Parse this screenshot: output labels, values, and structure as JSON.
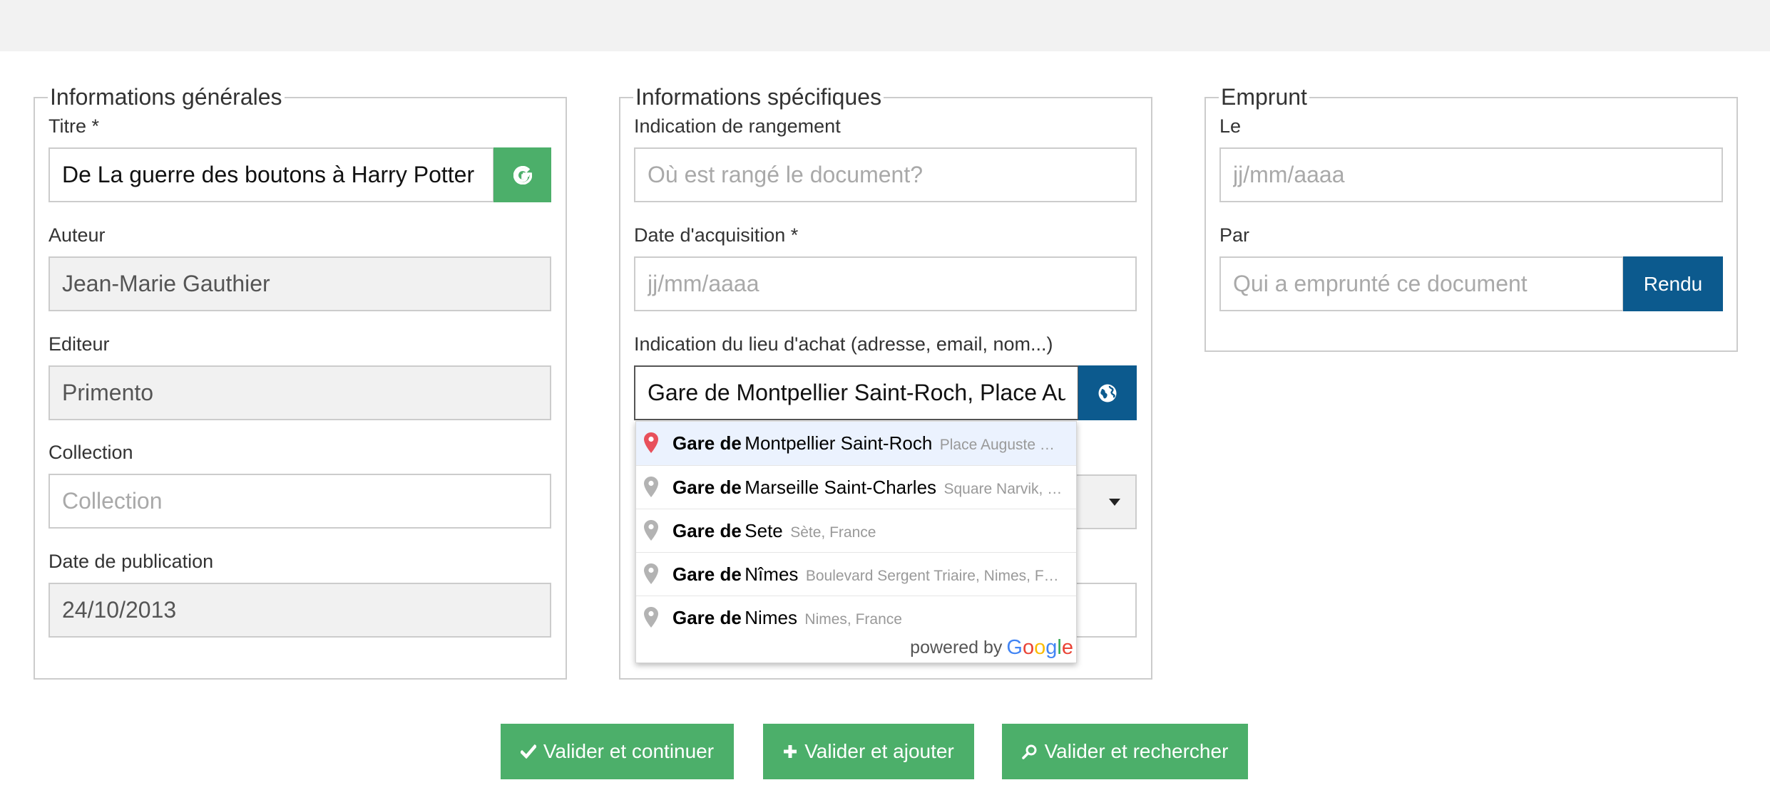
{
  "colors": {
    "green": "#4caf6a",
    "blue": "#0c5a8e",
    "border": "#cccccc",
    "readonly_bg": "#f1f1f1",
    "placeholder": "#a9a9a9"
  },
  "general": {
    "legend": "Informations générales",
    "titre_label": "Titre *",
    "titre_value": "De La guerre des boutons à Harry Potter",
    "google_button_icon": "google-g-icon",
    "auteur_label": "Auteur",
    "auteur_value": "Jean-Marie Gauthier",
    "editeur_label": "Editeur",
    "editeur_value": "Primento",
    "collection_label": "Collection",
    "collection_placeholder": "Collection",
    "date_label": "Date de publication",
    "date_value": "24/10/2013"
  },
  "specific": {
    "legend": "Informations spécifiques",
    "rangement_label": "Indication de rangement",
    "rangement_placeholder": "Où est rangé le document?",
    "acquisition_label": "Date d'acquisition *",
    "acquisition_placeholder": "jj/mm/aaaa",
    "lieu_label": "Indication du lieu d'achat (adresse, email, nom...)",
    "lieu_value": "Gare de Montpellier Saint-Roch, Place Auguste Gibert, Montpellier, France",
    "globe_button_icon": "globe-icon"
  },
  "autocomplete": {
    "items": [
      {
        "match": "Gare de",
        "main": "Montpellier Saint-Roch",
        "secondary": "Place Auguste …"
      },
      {
        "match": "Gare de",
        "main": "Marseille Saint-Charles",
        "secondary": "Square Narvik, …"
      },
      {
        "match": "Gare de",
        "main": "Sete",
        "secondary": "Sète, France"
      },
      {
        "match": "Gare de",
        "main": "Nîmes",
        "secondary": "Boulevard Sergent Triaire, Nimes, F…"
      },
      {
        "match": "Gare de",
        "main": "Nimes",
        "secondary": "Nimes, France"
      }
    ],
    "powered_by": "powered by",
    "logo_letters": [
      "G",
      "o",
      "o",
      "g",
      "l",
      "e"
    ],
    "logo_colors": [
      "#4285f4",
      "#ea4335",
      "#fbbc05",
      "#4285f4",
      "#34a853",
      "#ea4335"
    ],
    "active_pin_color": "#e8505b",
    "pin_color": "#b3b3b3"
  },
  "emprunt": {
    "legend": "Emprunt",
    "le_label": "Le",
    "le_placeholder": "jj/mm/aaaa",
    "par_label": "Par",
    "par_placeholder": "Qui a emprunté ce document",
    "rendu_button": "Rendu"
  },
  "actions": {
    "continuer": {
      "label": "Valider et continuer",
      "icon": "check-icon"
    },
    "ajouter": {
      "label": "Valider et ajouter",
      "icon": "plus-icon"
    },
    "rechercher": {
      "label": "Valider et rechercher",
      "icon": "search-icon"
    }
  }
}
